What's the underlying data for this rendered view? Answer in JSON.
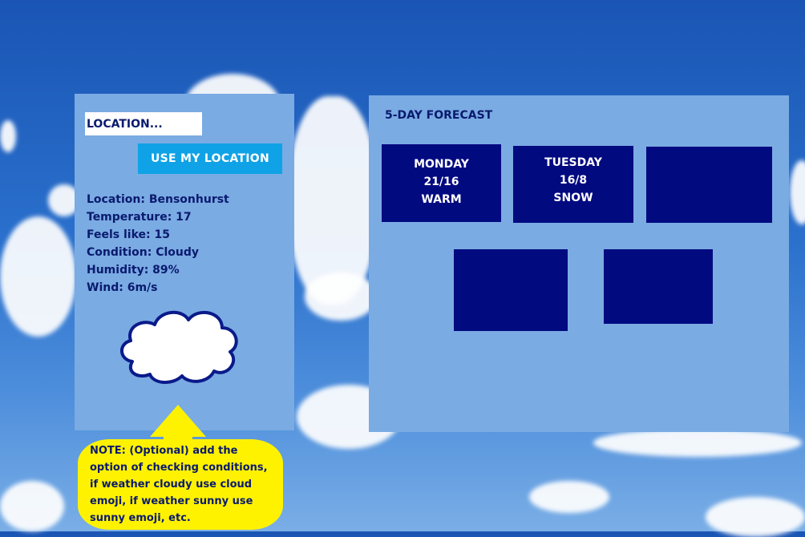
{
  "search": {
    "placeholder": "LOCATION...",
    "use_location_label": "USE MY LOCATION"
  },
  "current": {
    "location": "Location: Bensonhurst",
    "temperature": "Temperature: 17",
    "feels_like": "Feels like: 15",
    "condition": "Condition: Cloudy",
    "humidity": "Humidity: 89%",
    "wind": "Wind: 6m/s",
    "condition_icon": "cloud-icon"
  },
  "forecast": {
    "title": "5-DAY FORECAST",
    "days": [
      {
        "day": "MONDAY",
        "temps": "21/16",
        "desc": "WARM"
      },
      {
        "day": "TUESDAY",
        "temps": "16/8",
        "desc": "SNOW"
      },
      {
        "day": "",
        "temps": "",
        "desc": ""
      },
      {
        "day": "",
        "temps": "",
        "desc": ""
      },
      {
        "day": "",
        "temps": "",
        "desc": ""
      }
    ]
  },
  "note": {
    "text": "NOTE: (Optional) add the option of checking conditions, if weather cloudy use cloud emoji, if weather sunny use sunny emoji, etc."
  },
  "colors": {
    "panel": "#7aabe3",
    "card": "#020a80",
    "button": "#10a2e6",
    "text": "#0a1a6e",
    "note": "#fff200"
  }
}
